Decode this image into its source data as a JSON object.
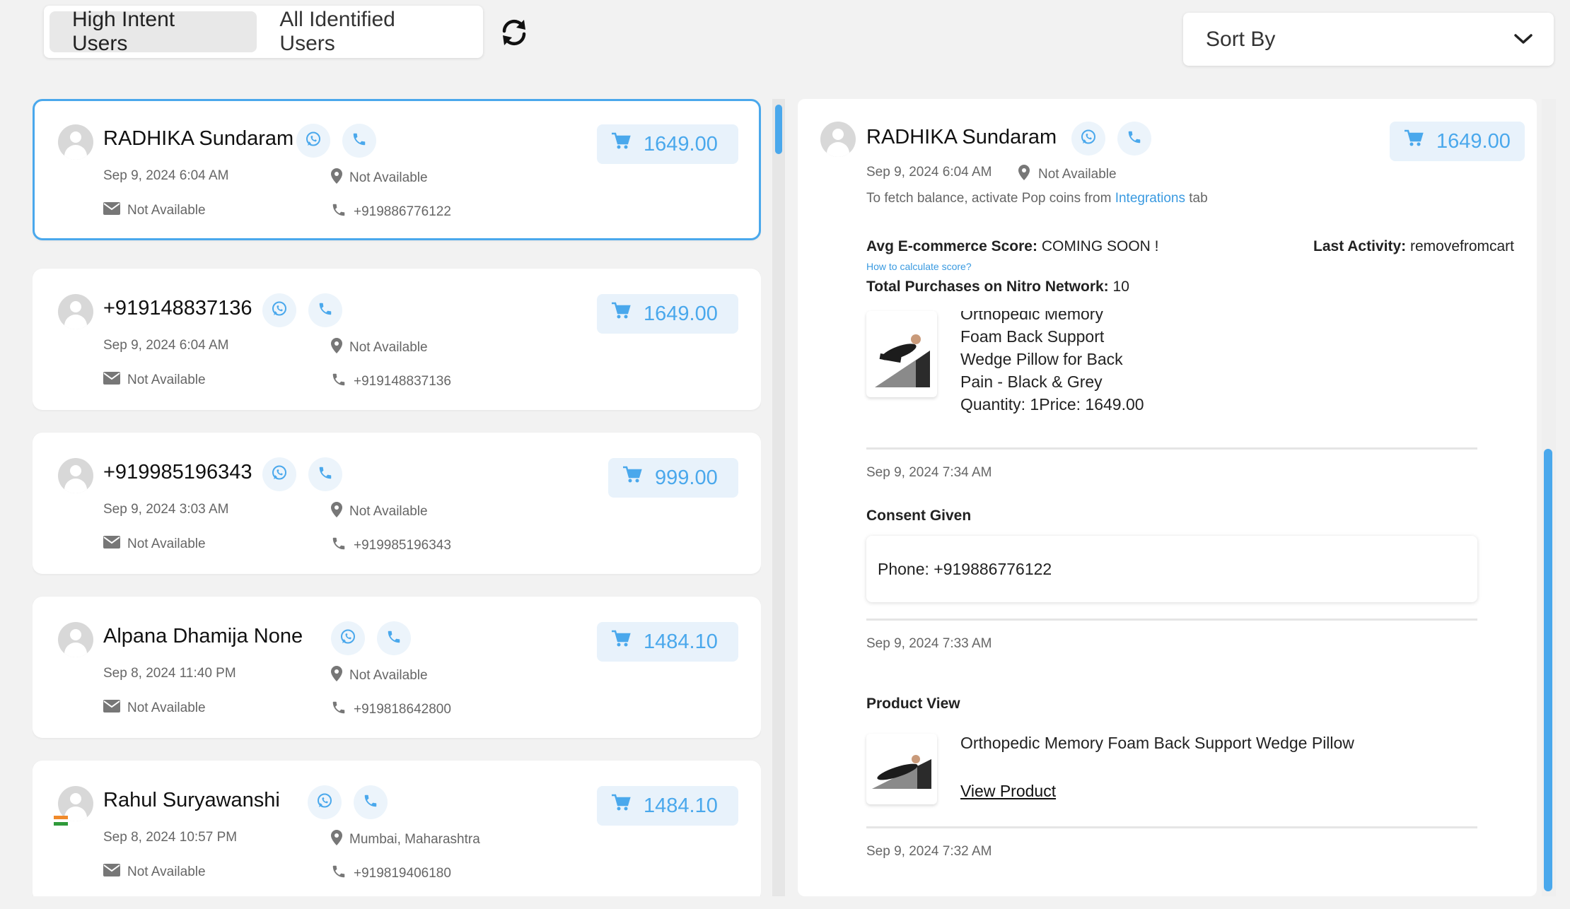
{
  "tabs": [
    {
      "label": "High Intent Users",
      "active": true
    },
    {
      "label": "All Identified Users",
      "active": false
    }
  ],
  "sort": {
    "label": "Sort By"
  },
  "users": [
    {
      "name": "RADHIKA Sundaram",
      "date": "Sep 9, 2024 6:04 AM",
      "location": "Not Available",
      "email": "Not Available",
      "phone": "+919886776122",
      "amount": "1649.00",
      "flag": false
    },
    {
      "name": "+919148837136",
      "date": "Sep 9, 2024 6:04 AM",
      "location": "Not Available",
      "email": "Not Available",
      "phone": "+919148837136",
      "amount": "1649.00",
      "flag": false
    },
    {
      "name": "+919985196343",
      "date": "Sep 9, 2024 3:03 AM",
      "location": "Not Available",
      "email": "Not Available",
      "phone": "+919985196343",
      "amount": "999.00",
      "flag": false
    },
    {
      "name": "Alpana Dhamija None",
      "date": "Sep 8, 2024 11:40 PM",
      "location": "Not Available",
      "email": "Not Available",
      "phone": "+919818642800",
      "amount": "1484.10",
      "flag": false
    },
    {
      "name": "Rahul Suryawanshi",
      "date": "Sep 8, 2024 10:57 PM",
      "location": "Mumbai, Maharashtra",
      "email": "Not Available",
      "phone": "+919819406180",
      "amount": "1484.10",
      "flag": true
    }
  ],
  "detail": {
    "name": "RADHIKA Sundaram",
    "date": "Sep 9, 2024 6:04 AM",
    "location": "Not Available",
    "amount": "1649.00",
    "balance_prefix": "To fetch balance, activate Pop coins from",
    "balance_link": "Integrations",
    "balance_suffix": "tab",
    "score_label": "Avg E-commerce Score:",
    "score_value": "COMING SOON !",
    "score_help": "How to calculate score?",
    "last_activity_label": "Last Activity:",
    "last_activity_value": "removefromcart",
    "purchases_label": "Total Purchases on Nitro Network:",
    "purchases_value": "10",
    "cart_product": {
      "lines": [
        "Orthopedic Memory",
        "Foam Back Support",
        "Wedge Pillow for Back",
        "Pain - Black & Grey",
        "Quantity: 1Price: 1649.00"
      ]
    },
    "events": [
      {
        "time": "Sep 9, 2024 7:34 AM"
      },
      {
        "time": "Sep 9, 2024 7:33 AM"
      },
      {
        "time": "Sep 9, 2024 7:32 AM"
      }
    ],
    "consent_title": "Consent Given",
    "consent_text": "Phone: +919886776122",
    "product_view_title": "Product View",
    "product_view_name": "Orthopedic Memory Foam Back Support Wedge Pillow",
    "view_product_label": "View Product"
  },
  "colors": {
    "accent": "#4aa8ec",
    "amount_bg": "#e8f2fb",
    "icon_btn_bg": "#ecf4fb"
  }
}
